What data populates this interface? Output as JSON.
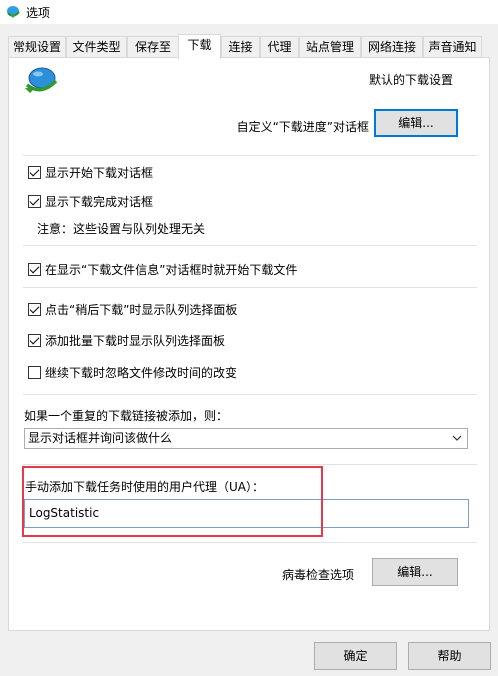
{
  "window": {
    "title": "选项"
  },
  "tabs": [
    {
      "label": "常规设置"
    },
    {
      "label": "文件类型"
    },
    {
      "label": "保存至"
    },
    {
      "label": "下载"
    },
    {
      "label": "连接"
    },
    {
      "label": "代理"
    },
    {
      "label": "站点管理"
    },
    {
      "label": "网络连接"
    },
    {
      "label": "声音通知"
    }
  ],
  "active_tab": "下载",
  "panel": {
    "header": "默认的下载设置",
    "progress_dialog_label": "自定义“下载进度”对话框",
    "edit_label": "编辑...",
    "checkboxes": [
      {
        "label": "显示开始下载对话框",
        "checked": true
      },
      {
        "label": "显示下载完成对话框",
        "checked": true
      },
      {
        "label": "在显示“下载文件信息”对话框时就开始下载文件",
        "checked": true
      },
      {
        "label": "点击“稍后下载”时显示队列选择面板",
        "checked": true
      },
      {
        "label": "添加批量下载时显示队列选择面板",
        "checked": true
      },
      {
        "label": "继续下载时忽略文件修改时间的改变",
        "checked": false
      }
    ],
    "note": "注意：这些设置与队列处理无关",
    "duplicate_label": "如果一个重复的下载链接被添加，则：",
    "duplicate_selected": "显示对话框并询问该做什么",
    "ua_label": "手动添加下载任务时使用的用户代理（UA）：",
    "ua_value": "LogStatistic",
    "virus_label": "病毒检查选项",
    "virus_edit_label": "编辑..."
  },
  "footer": {
    "ok_label": "确定",
    "help_label": "帮助"
  },
  "colors": {
    "highlight": "#e8384b",
    "focus": "#0078d7"
  }
}
